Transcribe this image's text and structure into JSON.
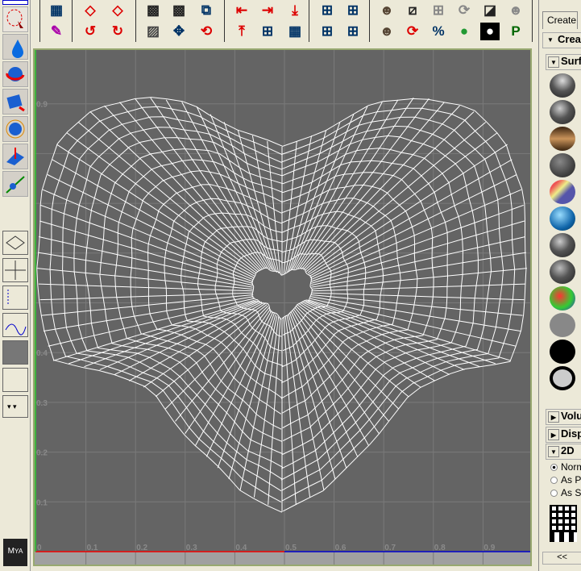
{
  "right_panel": {
    "tab": "Create",
    "header": "Crea",
    "sections": [
      {
        "label": "Surf",
        "open": true
      },
      {
        "label": "Volu",
        "open": false
      },
      {
        "label": "Disp",
        "open": false
      },
      {
        "label": "2D",
        "open": true
      }
    ],
    "radio": [
      "Norm",
      "As P",
      "As S"
    ],
    "radio_selected": 0,
    "collapse": "<<"
  },
  "uv_editor": {
    "u_labels": [
      "0",
      "0.1",
      "0.2",
      "0.3",
      "0.4",
      "0.5",
      "0.6",
      "0.7",
      "0.8",
      "0.9"
    ],
    "v_labels": [
      "0.1",
      "0.2",
      "0.3",
      "0.4",
      "0.9"
    ],
    "grid_color": "#7a7a7a",
    "bg": "#646464",
    "wire": "#ffffff"
  },
  "left_logo": "Maya"
}
